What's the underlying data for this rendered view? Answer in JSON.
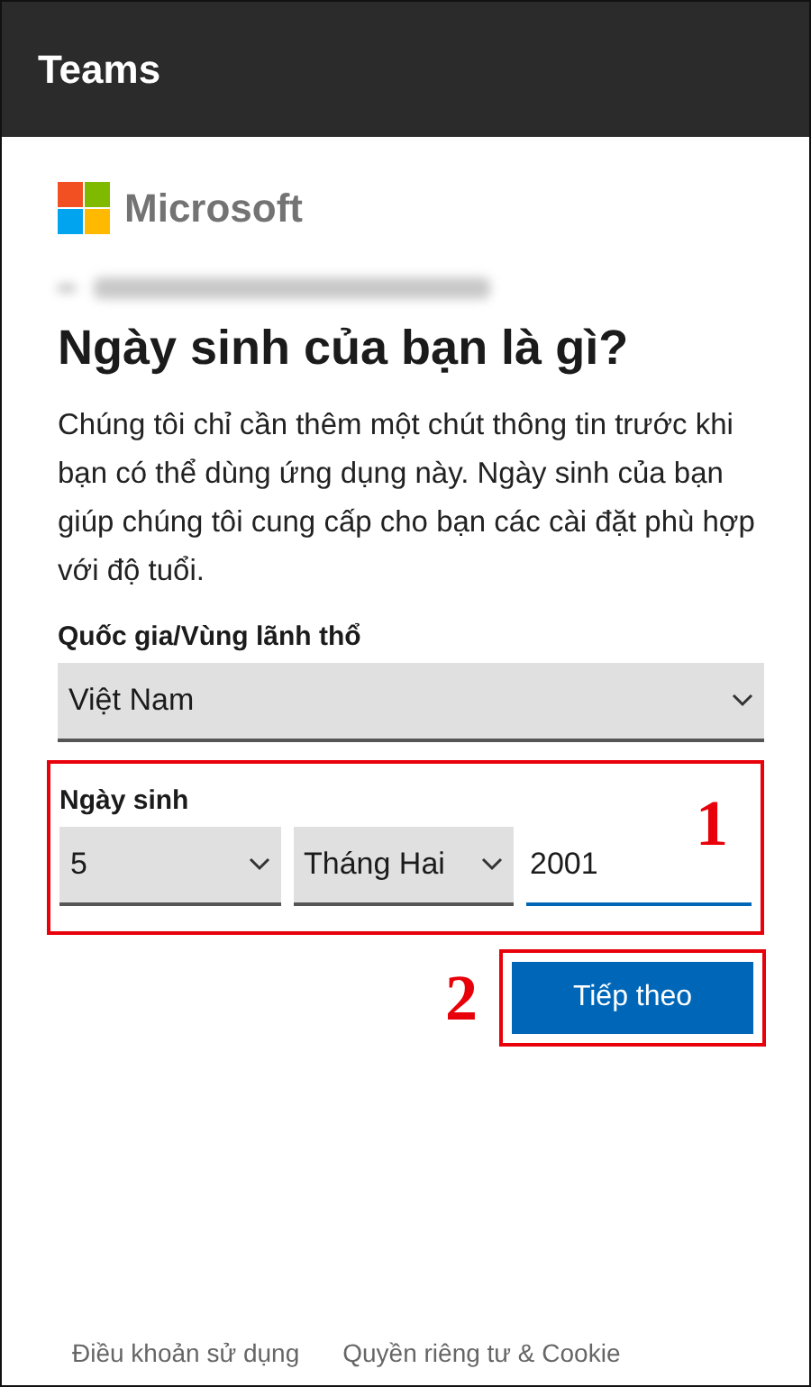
{
  "app_bar": {
    "title": "Teams"
  },
  "logo": {
    "text": "Microsoft"
  },
  "heading": "Ngày sinh của bạn là gì?",
  "description": "Chúng tôi chỉ cần thêm một chút thông tin trước khi bạn có thể dùng ứng dụng này. Ngày sinh của bạn giúp chúng tôi cung cấp cho bạn các cài đặt phù hợp với độ tuổi.",
  "country": {
    "label": "Quốc gia/Vùng lãnh thổ",
    "value": "Việt Nam"
  },
  "birthdate": {
    "label": "Ngày sinh",
    "day": "5",
    "month": "Tháng Hai",
    "year": "2001",
    "annotation": "1"
  },
  "next_button": {
    "label": "Tiếp theo",
    "annotation": "2"
  },
  "footer_links": [
    "Điều khoản sử dụng",
    "Quyền riêng tư & Cookie"
  ]
}
